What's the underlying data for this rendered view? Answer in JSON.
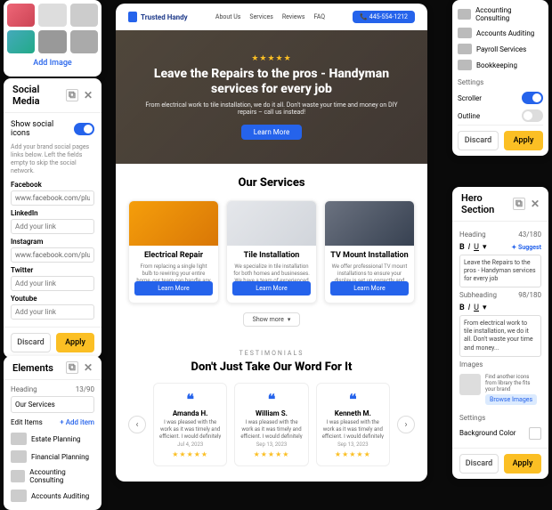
{
  "imgs": {
    "add": "Add Image"
  },
  "social": {
    "title": "Social Media",
    "show": "Show social icons",
    "hint": "Add your brand social pages links below. Left the fields empty to skip the social network.",
    "fields": [
      {
        "label": "Facebook",
        "value": "www.facebook.com/plumbing-wor..."
      },
      {
        "label": "LinkedIn",
        "value": "",
        "placeholder": "Add your link"
      },
      {
        "label": "Instagram",
        "value": "www.facebook.com/plumbing-wor..."
      },
      {
        "label": "Twitter",
        "value": "",
        "placeholder": "Add your link"
      },
      {
        "label": "Youtube",
        "value": "",
        "placeholder": "Add your link"
      }
    ],
    "discard": "Discard",
    "apply": "Apply"
  },
  "elements": {
    "title": "Elements",
    "heading_lbl": "Heading",
    "heading_cnt": "13/90",
    "heading_val": "Our Services",
    "edit_lbl": "Edit Items",
    "add": "+ Add item",
    "items": [
      "Estate Planning",
      "Financial Planning",
      "Accounting Consulting",
      "Accounts Auditing"
    ]
  },
  "rtop": {
    "items": [
      "Accounting Consulting",
      "Accounts Auditing",
      "Payroll Services",
      "Bookkeeping"
    ],
    "settings": "Settings",
    "scroller": "Scroller",
    "outline": "Outline",
    "discard": "Discard",
    "apply": "Apply"
  },
  "hero": {
    "title": "Hero Section",
    "heading_lbl": "Heading",
    "heading_cnt": "43/180",
    "suggest": "✦ Suggest",
    "heading_val": "Leave the Repairs to the pros - Handyman services for every job",
    "sub_lbl": "Subheading",
    "sub_cnt": "98/180",
    "sub_val": "From electrical work to tile installation, we do it all. Don't waste your time and money...",
    "images_lbl": "Images",
    "img_hint": "Find another icons from library the fits your brand",
    "browse": "Browse Images",
    "settings": "Settings",
    "bg": "Background Color",
    "discard": "Discard",
    "apply": "Apply"
  },
  "preview": {
    "logo": "Trusted Handy",
    "nav": [
      "About Us",
      "Services",
      "Reviews",
      "FAQ"
    ],
    "cta": "📞 445-554-1212",
    "h1": "Leave the Repairs to the pros - Handyman services for every job",
    "sub": "From electrical work to tile installation, we do it all. Don't waste your time and money on DIY repairs – call us instead!",
    "learn": "Learn More",
    "svc_h": "Our Services",
    "svc": [
      {
        "t": "Electrical Repair",
        "d": "From replacing a single light bulb to rewiring your entire home, our team can handle any electrical repair job. We wo...",
        "b": "Learn More"
      },
      {
        "t": "Tile Installation",
        "d": "We specialize in tile installation for both homes and businesses. We have a team of experienced professionals who can...",
        "b": "Learn More"
      },
      {
        "t": "TV Mount Installation",
        "d": "We offer professional TV mount installations to ensure your display is set up correctly and safely. Our technicians...",
        "b": "Learn More"
      }
    ],
    "show_more": "Show more",
    "test_k": "TESTIMONIALS",
    "test_h": "Don't Just Take Our Word For It",
    "tests": [
      {
        "n": "Amanda H.",
        "t": "I was pleased with the work as it was timely and efficient. I would definitely recommend Ora Flores.",
        "d": "Jul 4, 2023"
      },
      {
        "n": "William S.",
        "t": "I was pleased with the work as it was timely and efficient. I would definitely recommend Trusted Handy.",
        "d": "Sep 13, 2023"
      },
      {
        "n": "Kenneth M.",
        "t": "I was pleased with the work as it was timely and efficient. I would definitely recommend Trusted Handy.",
        "d": "Sep 13, 2023"
      }
    ]
  }
}
